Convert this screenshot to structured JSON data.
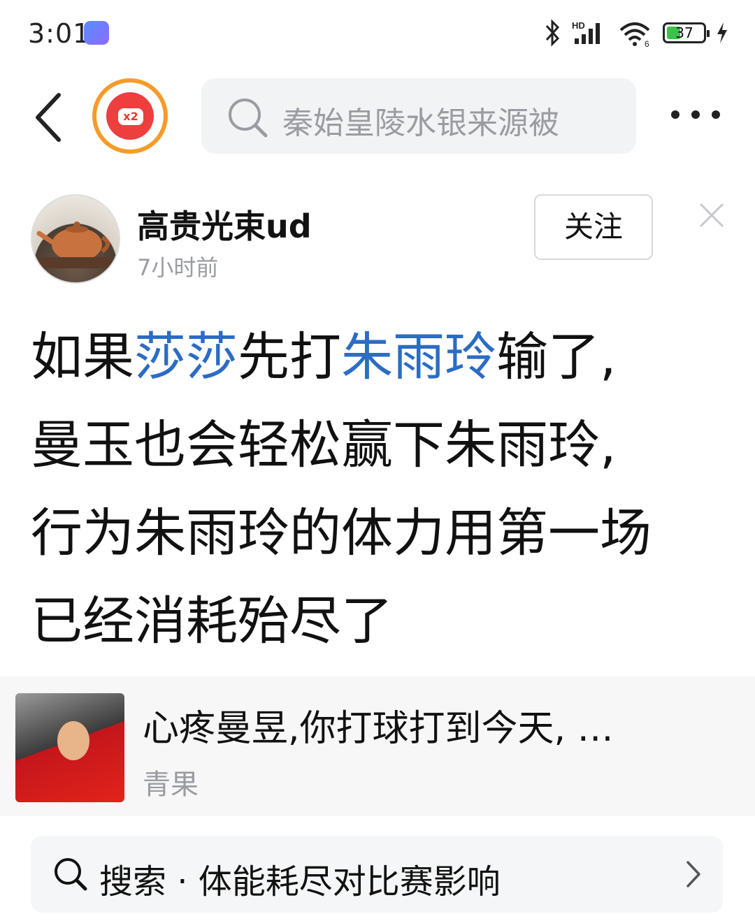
{
  "status_bar": {
    "time": "3:01",
    "network": "HD",
    "battery": "37",
    "battery_level": 0.37
  },
  "nav": {
    "search_placeholder": "秦始皇陵水银来源被",
    "redpacket_badge": "x2"
  },
  "author": {
    "name": "高贵光束ud",
    "time": "7小时前",
    "follow_label": "关注"
  },
  "post": {
    "line1_a": "如果",
    "line1_b": "莎莎",
    "line1_c": "先打",
    "line1_d": "朱雨玲",
    "line1_e": "输了,",
    "line2": "曼玉也会轻松赢下朱雨玲,",
    "line3": "行为朱雨玲的体力用第一场",
    "line4": "已经消耗殆尽了"
  },
  "related": {
    "title": "心疼曼昱,你打球打到今天, …",
    "source": "青果"
  },
  "bottom_search": {
    "label": "搜索 · 体能耗尽对比赛影响"
  },
  "colors": {
    "link": "#2b6cc4",
    "accent_orange": "#f59b2a",
    "red": "#ee3e3e"
  },
  "icons": [
    "app-icon",
    "bluetooth-icon",
    "signal-icon",
    "wifi-icon",
    "battery-icon",
    "charging-icon",
    "back-icon",
    "red-packet-icon",
    "search-icon",
    "more-icon",
    "close-icon",
    "chevron-right-icon"
  ]
}
